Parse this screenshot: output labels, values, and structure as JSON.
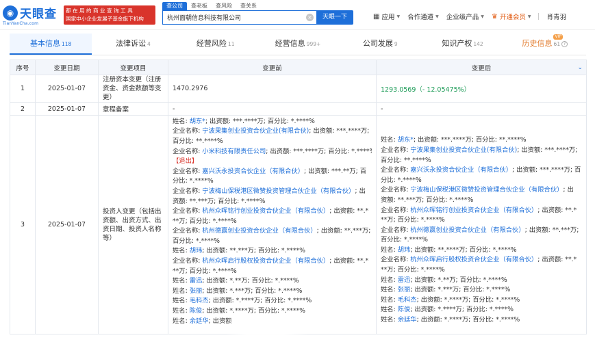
{
  "logo": {
    "name": "天眼查",
    "domain": "TianYanCha.com",
    "slogan_line1": "都 在 用 的 商 业 查 询 工 具",
    "slogan_line2": "国家中小企业发展子基金旗下机构"
  },
  "search": {
    "tabs": [
      {
        "label": "查公司",
        "active": true
      },
      {
        "label": "查老板",
        "active": false
      },
      {
        "label": "查风险",
        "active": false
      },
      {
        "label": "查关系",
        "active": false
      }
    ],
    "value": "杭州面朝信息科技有限公司",
    "button": "天眼一下"
  },
  "nav": {
    "app": "应用",
    "partner": "合作通道",
    "enterprise": "企业级产品",
    "vip": "开通会员",
    "user": "肖青羽"
  },
  "tabs": [
    {
      "label": "基本信息",
      "count": "118",
      "active": true
    },
    {
      "label": "法律诉讼",
      "count": "4",
      "active": false
    },
    {
      "label": "经营风险",
      "count": "11",
      "active": false
    },
    {
      "label": "经营信息",
      "count": "999+",
      "active": false
    },
    {
      "label": "公司发展",
      "count": "9",
      "active": false
    },
    {
      "label": "知识产权",
      "count": "142",
      "active": false
    },
    {
      "label": "历史信息",
      "count": "61",
      "active": false,
      "badge": "VIP"
    }
  ],
  "table": {
    "headers": {
      "seq": "序号",
      "date": "变更日期",
      "item": "变更项目",
      "before": "变更前",
      "after": "变更后"
    },
    "row1": {
      "seq": "1",
      "date": "2025-01-07",
      "item": "注册资本变更（注册资金、资金数额等变更）",
      "before": "1470.2976",
      "after": "1293.0569（- 12.05475%）"
    },
    "row2": {
      "seq": "2",
      "date": "2025-01-07",
      "item": "章程备案",
      "before": "-",
      "after": "-"
    },
    "row3": {
      "seq": "3",
      "date": "2025-01-07",
      "item": "投资人变更（包括出资额、出资方式、出资日期、投资人名称等）",
      "before_lines": [
        [
          {
            "t": "姓名: "
          },
          {
            "t": "胡东*",
            "c": "lk"
          },
          {
            "t": "; 出资额: ***.****万; 百分比: *.****%"
          }
        ],
        [
          {
            "t": "企业名称: "
          },
          {
            "t": "宁波果集创业投资合伙企业(有限合伙)",
            "c": "lk"
          },
          {
            "t": "; 出资额: ***.****万;"
          }
        ],
        [
          {
            "t": "百分比: **.****%"
          }
        ],
        [
          {
            "t": "企业名称: "
          },
          {
            "t": "小米科技有限责任公司",
            "c": "lk"
          },
          {
            "t": "; 出资额: ***.****万; 百分比: *.****%"
          }
        ],
        [
          {
            "t": "【退出】",
            "c": "red"
          }
        ],
        [
          {
            "t": "企业名称: "
          },
          {
            "t": "嘉兴沃永投资合伙企业（有限合伙）",
            "c": "lk"
          },
          {
            "t": "; 出资额: ***.**万; 百"
          }
        ],
        [
          {
            "t": "分比: *.****%"
          }
        ],
        [
          {
            "t": "企业名称: "
          },
          {
            "t": "宁波梅山保税港区微赞投资管理合伙企业（有限合伙）",
            "c": "lk"
          },
          {
            "t": "; 出"
          }
        ],
        [
          {
            "t": "资额: **.***万; 百分比: *.****%"
          }
        ],
        [
          {
            "t": "企业名称: "
          },
          {
            "t": "杭州众晖铭行创业投资合伙企业（有限合伙）",
            "c": "lk"
          },
          {
            "t": "; 出资额: **.*"
          }
        ],
        [
          {
            "t": "**万; 百分比: *.****%"
          }
        ],
        [
          {
            "t": "企业名称: "
          },
          {
            "t": "杭州德赢创业投资合伙企业（有限合伙）",
            "c": "lk"
          },
          {
            "t": "; 出资额: **.***万;"
          }
        ],
        [
          {
            "t": "百分比: *.****%"
          }
        ],
        [
          {
            "t": "姓名: "
          },
          {
            "t": "胡玮",
            "c": "lk"
          },
          {
            "t": "; 出资额: **.***万; 百分比: *.****%"
          }
        ],
        [
          {
            "t": "企业名称: "
          },
          {
            "t": "杭州众晖启行股权投资合伙企业（有限合伙）",
            "c": "lk"
          },
          {
            "t": "; 出资额: **.*"
          }
        ],
        [
          {
            "t": "**万; 百分比: *.****%"
          }
        ],
        [
          {
            "t": "姓名: "
          },
          {
            "t": "雷迅",
            "c": "lk"
          },
          {
            "t": "; 出资额: *.**万; 百分比: *.****%"
          }
        ],
        [
          {
            "t": "姓名: "
          },
          {
            "t": "张丽",
            "c": "lk"
          },
          {
            "t": "; 出资额: *.***万; 百分比: *.****%"
          }
        ],
        [
          {
            "t": "姓名: "
          },
          {
            "t": "毛科杰",
            "c": "lk"
          },
          {
            "t": "; 出资额: *.****万; 百分比: *.****%"
          }
        ],
        [
          {
            "t": "姓名: "
          },
          {
            "t": "陈俊",
            "c": "lk"
          },
          {
            "t": "; 出资额: *.****万; 百分比: *.****%"
          }
        ],
        [
          {
            "t": "姓名: "
          },
          {
            "t": "余廷华",
            "c": "lk"
          },
          {
            "t": "; 出资额"
          }
        ]
      ],
      "after_lines": [
        [
          {
            "t": "姓名: "
          },
          {
            "t": "胡东*",
            "c": "lk"
          },
          {
            "t": "; 出资额: ***.****万; 百分比: **.****%"
          }
        ],
        [
          {
            "t": "企业名称: "
          },
          {
            "t": "宁波果集创业投资合伙企业(有限合伙)",
            "c": "lk"
          },
          {
            "t": "; 出资额: ***.****万;"
          }
        ],
        [
          {
            "t": "百分比: **.****%"
          }
        ],
        [
          {
            "t": "企业名称: "
          },
          {
            "t": "嘉兴沃永投资合伙企业（有限合伙）",
            "c": "lk"
          },
          {
            "t": "; 出资额: ***.****万; 百"
          }
        ],
        [
          {
            "t": "分比: *.****%"
          }
        ],
        [
          {
            "t": "企业名称: "
          },
          {
            "t": "宁波梅山保税港区微赞投资管理合伙企业（有限合伙）",
            "c": "lk"
          },
          {
            "t": "; 出"
          }
        ],
        [
          {
            "t": "资额: **.***万; 百分比: *.****%"
          }
        ],
        [
          {
            "t": "企业名称: "
          },
          {
            "t": "杭州众晖铭行创业投资合伙企业（有限合伙）",
            "c": "lk"
          },
          {
            "t": "; 出资额: **.*"
          }
        ],
        [
          {
            "t": "**万; 百分比: *.****%"
          }
        ],
        [
          {
            "t": "企业名称: "
          },
          {
            "t": "杭州德赢创业投资合伙企业（有限合伙）",
            "c": "lk"
          },
          {
            "t": "; 出资额: **.***万;"
          }
        ],
        [
          {
            "t": "百分比: *.****%"
          }
        ],
        [
          {
            "t": "姓名: "
          },
          {
            "t": "胡玮",
            "c": "lk"
          },
          {
            "t": "; 出资额: **.****万; 百分比: *.****%"
          }
        ],
        [
          {
            "t": "企业名称: "
          },
          {
            "t": "杭州众晖启行股权投资合伙企业（有限合伙）",
            "c": "lk"
          },
          {
            "t": "; 出资额: **.*"
          }
        ],
        [
          {
            "t": "**万; 百分比: *.****%"
          }
        ],
        [
          {
            "t": "姓名: "
          },
          {
            "t": "雷迅",
            "c": "lk"
          },
          {
            "t": "; 出资额: *.**万; 百分比: *.****%"
          }
        ],
        [
          {
            "t": "姓名: "
          },
          {
            "t": "张丽",
            "c": "lk"
          },
          {
            "t": "; 出资额: *.***万; 百分比: *.****%"
          }
        ],
        [
          {
            "t": "姓名: "
          },
          {
            "t": "毛科杰",
            "c": "lk"
          },
          {
            "t": "; 出资额: *.****万; 百分比: *.****%"
          }
        ],
        [
          {
            "t": "姓名: "
          },
          {
            "t": "陈俊",
            "c": "lk"
          },
          {
            "t": "; 出资额: *.****万; 百分比: *.****%"
          }
        ],
        [
          {
            "t": "姓名: "
          },
          {
            "t": "余廷华",
            "c": "lk"
          },
          {
            "t": "; 出资额: *.****万; 百分比: *.****%"
          }
        ]
      ]
    }
  }
}
